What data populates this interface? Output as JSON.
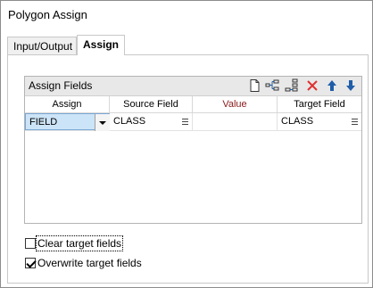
{
  "window": {
    "title": "Polygon Assign"
  },
  "tabs": [
    {
      "label": "Input/Output",
      "active": false
    },
    {
      "label": "Assign",
      "active": true
    }
  ],
  "assign_fields": {
    "title": "Assign Fields",
    "toolbar_icons": [
      "new-row-icon",
      "insert-row-icon",
      "append-row-icon",
      "delete-icon",
      "move-up-icon",
      "move-down-icon"
    ],
    "delete_color": "#e03030",
    "arrow_color": "#1f5ea8",
    "columns": [
      {
        "label": "Assign",
        "color": "#000000"
      },
      {
        "label": "Source Field",
        "color": "#000000"
      },
      {
        "label": "Value",
        "color": "#8b1a1a"
      },
      {
        "label": "Target Field",
        "color": "#000000"
      }
    ],
    "rows": [
      {
        "assign": "FIELD",
        "source": "CLASS",
        "value": "",
        "target": "CLASS"
      }
    ]
  },
  "options": {
    "clear_target": {
      "label": "Clear target fields",
      "checked": false
    },
    "overwrite_target": {
      "label": "Overwrite target fields",
      "checked": true
    }
  }
}
